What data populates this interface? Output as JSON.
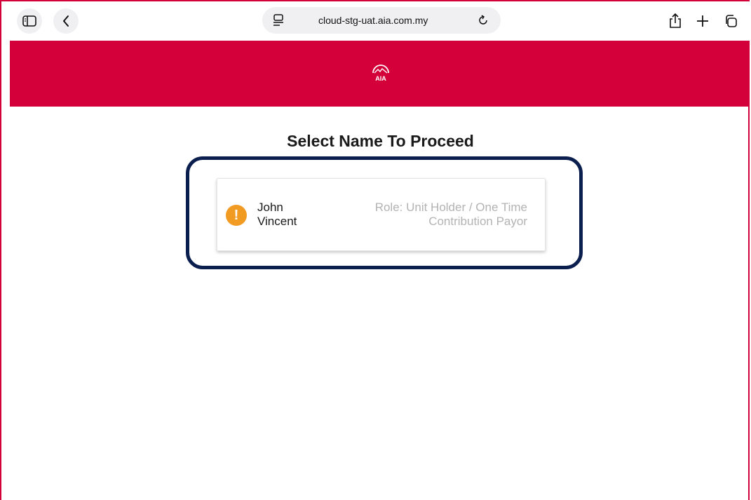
{
  "browser": {
    "url": "cloud-stg-uat.aia.com.my",
    "icons": {
      "sidebar": "sidebar-icon",
      "back": "chevron-left-icon",
      "page_settings": "page-settings-icon",
      "reload": "reload-icon",
      "share": "share-icon",
      "new_tab": "plus-icon",
      "tabs": "tabs-overview-icon"
    }
  },
  "header": {
    "brand_color": "#d4003a",
    "logo": "aia-logo-icon"
  },
  "page": {
    "title": "Select Name To Proceed",
    "accent_outline_color": "#0a1f4e"
  },
  "cards": [
    {
      "status_icon": "warning-icon",
      "status_symbol": "!",
      "status_color": "#f29b22",
      "name_line1": "John",
      "name_line2": "Vincent",
      "role_line1": "Role: Unit Holder / One Time",
      "role_line2": "Contribution Payor"
    }
  ]
}
